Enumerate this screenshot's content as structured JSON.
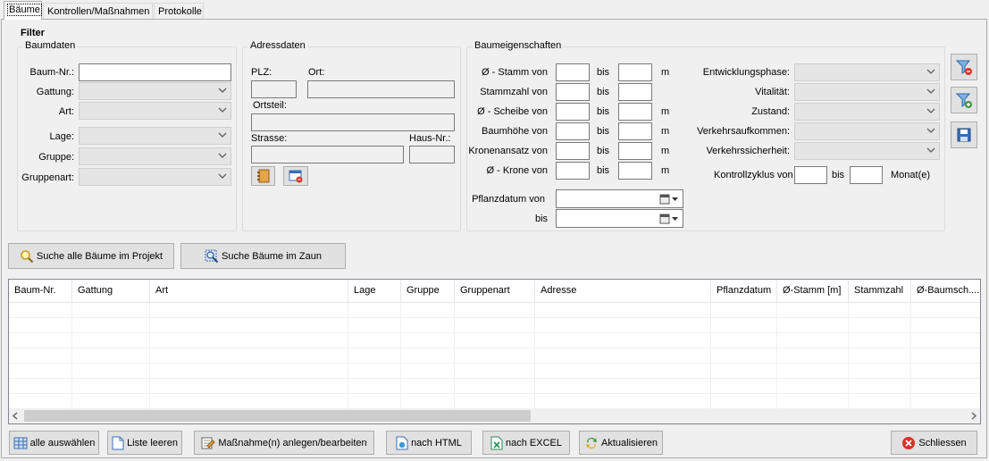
{
  "tabs": [
    "Bäume",
    "Kontrollen/Maßnahmen",
    "Protokolle"
  ],
  "filter_title": "Filter",
  "baumdaten": {
    "title": "Baumdaten",
    "baum_nr": "Baum-Nr.:",
    "gattung": "Gattung:",
    "art": "Art:",
    "lage": "Lage:",
    "gruppe": "Gruppe:",
    "gruppenart": "Gruppenart:"
  },
  "adressdaten": {
    "title": "Adressdaten",
    "plz": "PLZ:",
    "ort": "Ort:",
    "ortsteil": "Ortsteil:",
    "strasse": "Strasse:",
    "haus_nr": "Haus-Nr.:"
  },
  "baumeigenschaften": {
    "title": "Baumeigenschaften",
    "rows": [
      {
        "label": "Ø - Stamm von",
        "bis": "bis",
        "unit": "m"
      },
      {
        "label": "Stammzahl von",
        "bis": "bis",
        "unit": ""
      },
      {
        "label": "Ø - Scheibe von",
        "bis": "bis",
        "unit": "m"
      },
      {
        "label": "Baumhöhe von",
        "bis": "bis",
        "unit": "m"
      },
      {
        "label": "Kronenansatz von",
        "bis": "bis",
        "unit": "m"
      },
      {
        "label": "Ø - Krone von",
        "bis": "bis",
        "unit": "m"
      }
    ],
    "pflanzdatum_von": "Pflanzdatum von",
    "pflanzdatum_bis": "bis",
    "entwicklungsphase": "Entwicklungsphase:",
    "vitalitaet": "Vitalität:",
    "zustand": "Zustand:",
    "verkehrsaufkommen": "Verkehrsaufkommen:",
    "verkehrssicherheit": "Verkehrssicherheit:",
    "kontrollzyklus_von": "Kontrollzyklus von",
    "kontrollzyklus_bis": "bis",
    "monat": "Monat(e)"
  },
  "search": {
    "alle": "Suche alle Bäume im Projekt",
    "zaun": "Suche Bäume im Zaun"
  },
  "table": {
    "columns": [
      "Baum-Nr.",
      "Gattung",
      "Art",
      "Lage",
      "Gruppe",
      "Gruppenart",
      "Adresse",
      "Pflanzdatum",
      "Ø-Stamm [m]",
      "Stammzahl",
      "Ø-Baumsch...."
    ],
    "rows": []
  },
  "bottom": {
    "alle_auswaehlen": "alle auswählen",
    "liste_leeren": "Liste leeren",
    "massnahmen": "Maßnahme(n) anlegen/bearbeiten",
    "html": "nach HTML",
    "excel": "nach EXCEL",
    "aktualisieren": "Aktualisieren",
    "schliessen": "Schliessen"
  },
  "colors": {
    "accent": "#0078d7",
    "close_red": "#d9322a",
    "excel_green": "#2e8b57"
  }
}
